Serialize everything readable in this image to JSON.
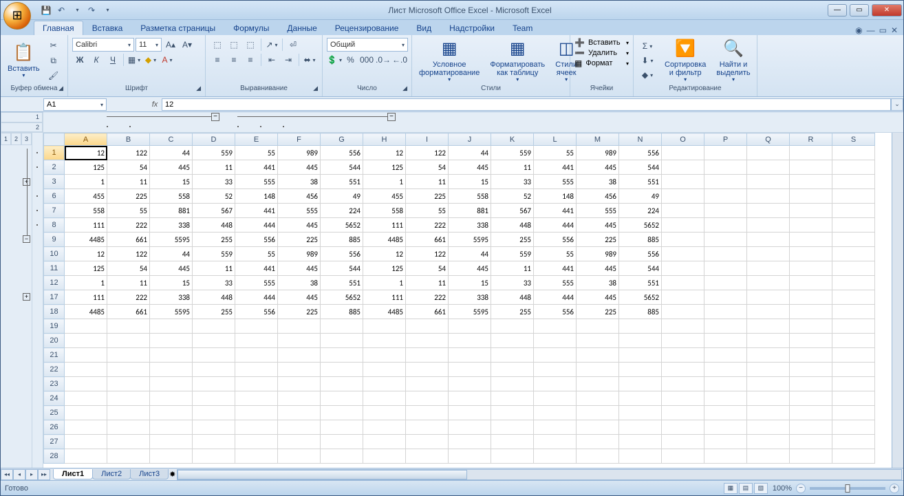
{
  "title": "Лист Microsoft Office Excel - Microsoft Excel",
  "qat": {
    "save": "💾",
    "undo": "↶",
    "redo": "↷"
  },
  "tabs": [
    "Главная",
    "Вставка",
    "Разметка страницы",
    "Формулы",
    "Данные",
    "Рецензирование",
    "Вид",
    "Надстройки",
    "Team"
  ],
  "active_tab": 0,
  "ribbon": {
    "clipboard": {
      "paste": "Вставить",
      "label": "Буфер обмена"
    },
    "font": {
      "name": "Calibri",
      "size": "11",
      "bold": "Ж",
      "italic": "К",
      "underline": "Ч",
      "label": "Шрифт"
    },
    "alignment": {
      "label": "Выравнивание"
    },
    "number": {
      "format": "Общий",
      "label": "Число"
    },
    "styles": {
      "cond": "Условное форматирование",
      "table": "Форматировать как таблицу",
      "cell": "Стили ячеек",
      "label": "Стили"
    },
    "cells": {
      "insert": "Вставить",
      "delete": "Удалить",
      "format": "Формат",
      "label": "Ячейки"
    },
    "editing": {
      "sort": "Сортировка и фильтр",
      "find": "Найти и выделить",
      "label": "Редактирование"
    }
  },
  "namebox": "A1",
  "formula": "12",
  "columns": [
    "A",
    "B",
    "C",
    "D",
    "E",
    "F",
    "G",
    "H",
    "I",
    "J",
    "K",
    "L",
    "M",
    "N",
    "O",
    "P",
    "Q",
    "R",
    "S"
  ],
  "visible_rows": [
    1,
    2,
    3,
    6,
    7,
    8,
    9,
    10,
    11,
    12,
    17,
    18,
    19,
    20,
    21,
    22,
    23,
    24,
    25,
    26,
    27,
    28
  ],
  "row_outline_levels": [
    "1",
    "2",
    "3"
  ],
  "col_outline_levels": [
    "1",
    "2"
  ],
  "grid_data": {
    "1": [
      12,
      122,
      44,
      559,
      55,
      989,
      556,
      12,
      122,
      44,
      559,
      55,
      989,
      556
    ],
    "2": [
      125,
      54,
      445,
      11,
      441,
      445,
      544,
      125,
      54,
      445,
      11,
      441,
      445,
      544
    ],
    "3": [
      1,
      11,
      15,
      33,
      555,
      38,
      551,
      1,
      11,
      15,
      33,
      555,
      38,
      551
    ],
    "6": [
      455,
      225,
      558,
      52,
      148,
      456,
      49,
      455,
      225,
      558,
      52,
      148,
      456,
      49
    ],
    "7": [
      558,
      55,
      881,
      567,
      441,
      555,
      224,
      558,
      55,
      881,
      567,
      441,
      555,
      224
    ],
    "8": [
      111,
      222,
      338,
      448,
      444,
      445,
      5652,
      111,
      222,
      338,
      448,
      444,
      445,
      5652
    ],
    "9": [
      4485,
      661,
      5595,
      255,
      556,
      225,
      885,
      4485,
      661,
      5595,
      255,
      556,
      225,
      885
    ],
    "10": [
      12,
      122,
      44,
      559,
      55,
      989,
      556,
      12,
      122,
      44,
      559,
      55,
      989,
      556
    ],
    "11": [
      125,
      54,
      445,
      11,
      441,
      445,
      544,
      125,
      54,
      445,
      11,
      441,
      445,
      544
    ],
    "12": [
      1,
      11,
      15,
      33,
      555,
      38,
      551,
      1,
      11,
      15,
      33,
      555,
      38,
      551
    ],
    "17": [
      111,
      222,
      338,
      448,
      444,
      445,
      5652,
      111,
      222,
      338,
      448,
      444,
      445,
      5652
    ],
    "18": [
      4485,
      661,
      5595,
      255,
      556,
      225,
      885,
      4485,
      661,
      5595,
      255,
      556,
      225,
      885
    ]
  },
  "sheets": [
    "Лист1",
    "Лист2",
    "Лист3"
  ],
  "active_sheet": 0,
  "status": {
    "ready": "Готово",
    "zoom": "100%"
  }
}
